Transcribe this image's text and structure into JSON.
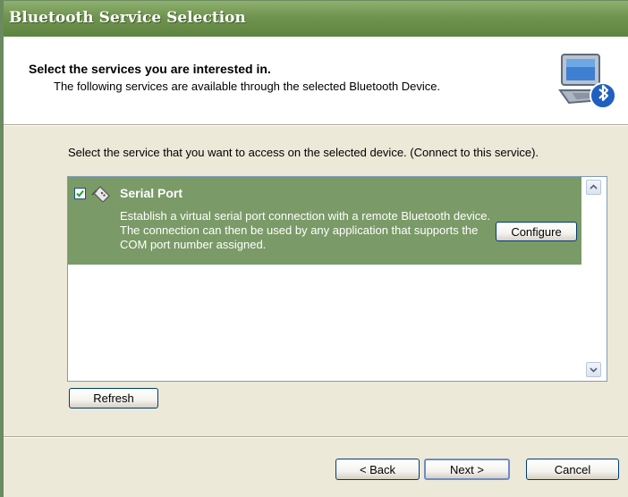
{
  "window": {
    "title": "Bluetooth Service Selection"
  },
  "header": {
    "title": "Select the services you are interested in.",
    "subtitle": "The following services are available through the selected Bluetooth Device."
  },
  "main": {
    "instruction": "Select the service that you want to access on the selected device. (Connect to this service).",
    "services": [
      {
        "name": "Serial Port",
        "checked": true,
        "description": "Establish a virtual serial port connection with a remote Bluetooth device. The connection can then be used by any application that supports the COM port number assigned.",
        "configure_label": "Configure"
      }
    ],
    "refresh_label": "Refresh"
  },
  "footer": {
    "back_label": "< Back",
    "next_label": "Next >",
    "cancel_label": "Cancel"
  },
  "colors": {
    "title_bar": "#6F944F",
    "selected_item": "#7A9A67",
    "dialog_bg": "#ECE9D8"
  }
}
